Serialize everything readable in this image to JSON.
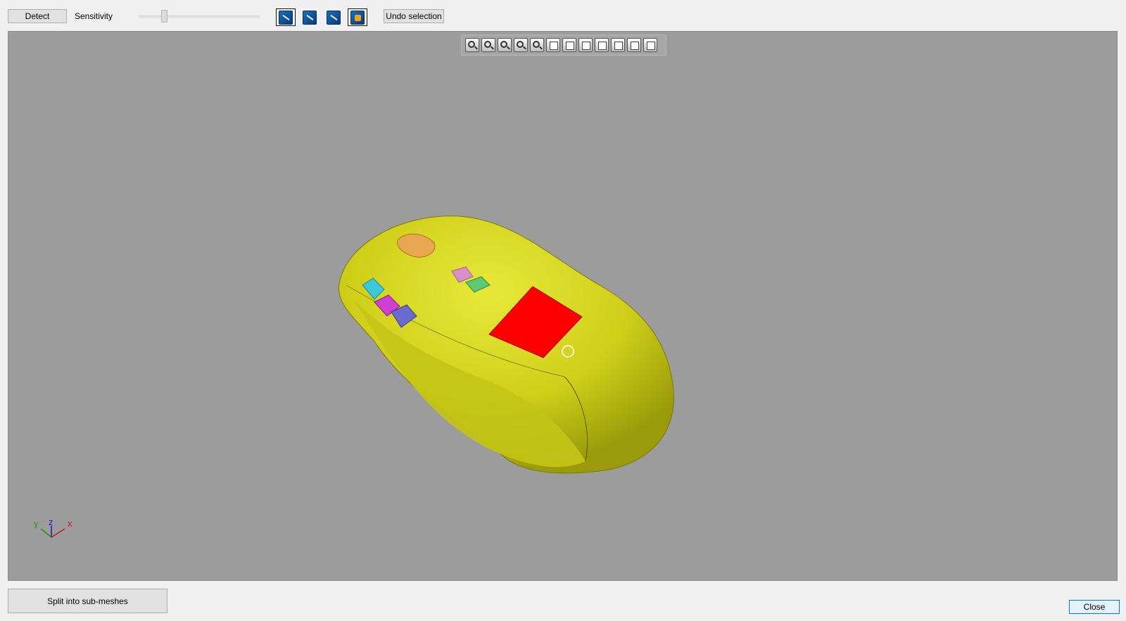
{
  "toolbar": {
    "detect_label": "Detect",
    "sensitivity_label": "Sensitivity",
    "sensitivity_value": 0.2,
    "undo_label": "Undo selection",
    "tools": [
      {
        "icon": "select-edge-icon",
        "active": true
      },
      {
        "icon": "select-curve-icon",
        "active": false
      },
      {
        "icon": "select-polyline-icon",
        "active": false
      },
      {
        "icon": "select-region-icon",
        "active": true
      }
    ]
  },
  "view_toolbar": {
    "icons": [
      "zoom-fit-icon",
      "zoom-icon",
      "rotate-icon",
      "pan-icon",
      "zoom-in-icon",
      "view-front-icon",
      "view-back-icon",
      "view-left-icon",
      "view-right-icon",
      "view-top-icon",
      "view-bottom-icon",
      "view-iso-icon"
    ]
  },
  "axis": {
    "x": "x",
    "y": "y",
    "z": "z"
  },
  "footer": {
    "split_label": "Split into sub-meshes",
    "close_label": "Close"
  },
  "colors": {
    "mesh": "#d4d41e",
    "selection": "#ff0000",
    "viewport_bg": "#9c9c9c"
  }
}
